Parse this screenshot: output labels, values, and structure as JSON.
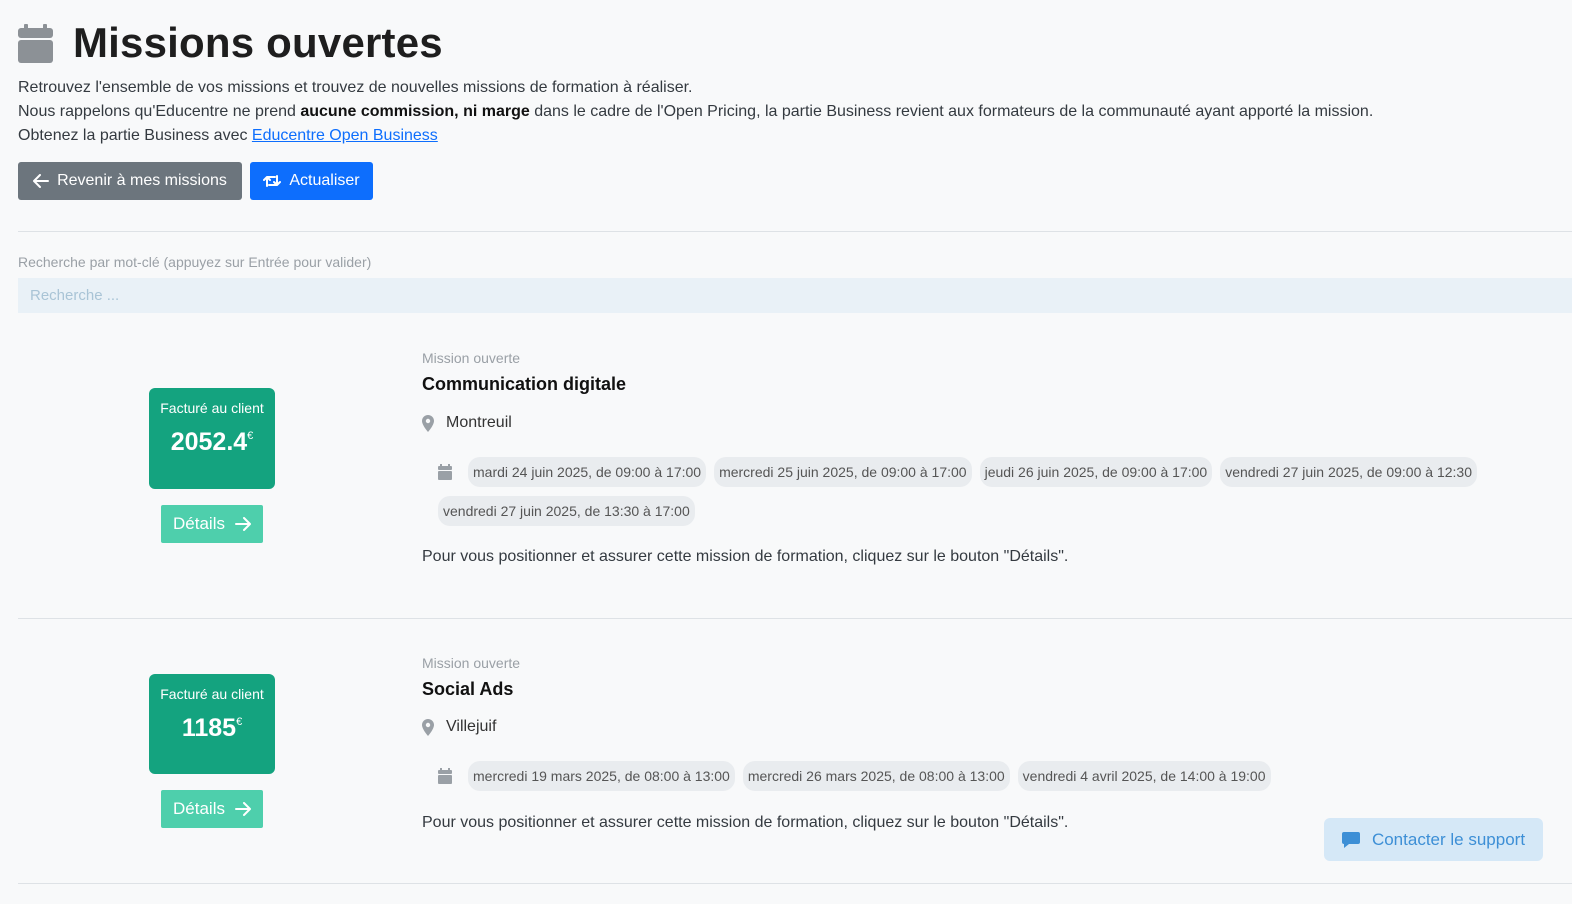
{
  "header": {
    "title": "Missions ouvertes",
    "icon": "calendar-icon"
  },
  "intro": {
    "line1": "Retrouvez l'ensemble de vos missions et trouvez de nouvelles missions de formation à réaliser.",
    "line2_before": "Nous rappelons qu'Educentre ne prend ",
    "line2_bold": "aucune commission, ni marge",
    "line2_after": " dans le cadre de l'Open Pricing, la partie Business revient aux formateurs de la communauté ayant apporté la mission.",
    "line3_before": "Obtenez la partie Business avec ",
    "line3_link": "Educentre Open Business"
  },
  "toolbar": {
    "back_label": "Revenir à mes missions",
    "refresh_label": "Actualiser"
  },
  "search": {
    "label": "Recherche par mot-clé (appuyez sur Entrée pour valider)",
    "placeholder": "Recherche ...",
    "value": ""
  },
  "missions": [
    {
      "price_label": "Facturé au client",
      "price": "2052.4",
      "currency": "€",
      "details_label": "Détails",
      "status": "Mission ouverte",
      "title": "Communication digitale",
      "location": "Montreuil",
      "dates": [
        "mardi 24 juin 2025, de 09:00 à 17:00",
        "mercredi 25 juin 2025, de 09:00 à 17:00",
        "jeudi 26 juin 2025, de 09:00 à 17:00",
        "vendredi 27 juin 2025, de 09:00 à 12:30",
        "vendredi 27 juin 2025, de 13:30 à 17:00"
      ],
      "description": "Pour vous positionner et assurer cette mission de formation, cliquez sur le bouton \"Détails\"."
    },
    {
      "price_label": "Facturé au client",
      "price": "1185",
      "currency": "€",
      "details_label": "Détails",
      "status": "Mission ouverte",
      "title": "Social Ads",
      "location": "Villejuif",
      "dates": [
        "mercredi 19 mars 2025, de 08:00 à 13:00",
        "mercredi 26 mars 2025, de 08:00 à 13:00",
        "vendredi 4 avril 2025, de 14:00 à 19:00"
      ],
      "description": "Pour vous positionner et assurer cette mission de formation, cliquez sur le bouton \"Détails\"."
    }
  ],
  "support": {
    "label": "Contacter le support"
  },
  "colors": {
    "price_card": "#14a37f",
    "details_button": "#4ecfac",
    "primary": "#0d6efd",
    "secondary": "#6c757d",
    "support_bg": "#d5e8f7",
    "support_text": "#3d8fd6"
  }
}
